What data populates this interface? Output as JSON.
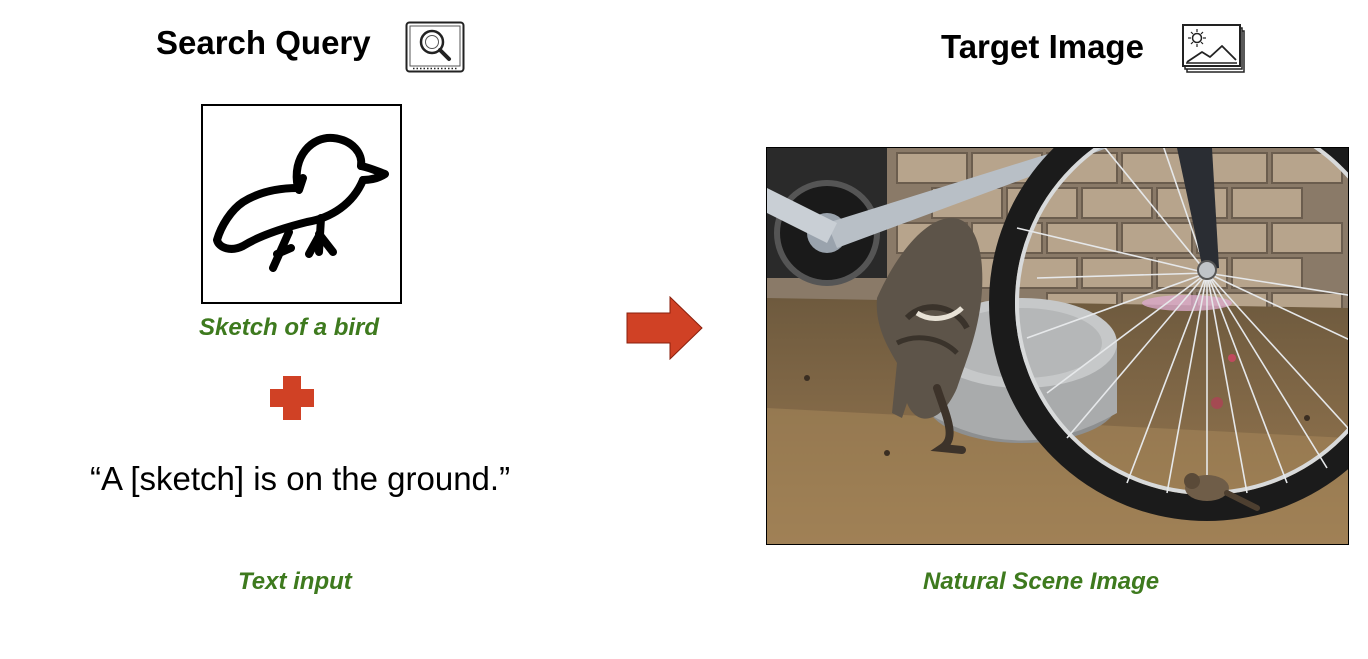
{
  "query": {
    "title": "Search Query",
    "title_icon": "search-image-icon",
    "sketch_caption": "Sketch of a bird",
    "combine_icon": "plus-icon",
    "text_query": "“A [sketch] is on the ground.”",
    "text_caption": "Text input"
  },
  "target": {
    "title": "Target Image",
    "title_icon": "landscape-image-icon",
    "caption": "Natural Scene Image"
  },
  "flow_icon": "arrow-right-icon",
  "colors": {
    "caption_green": "#3e7a1e",
    "accent_red": "#d04125"
  }
}
